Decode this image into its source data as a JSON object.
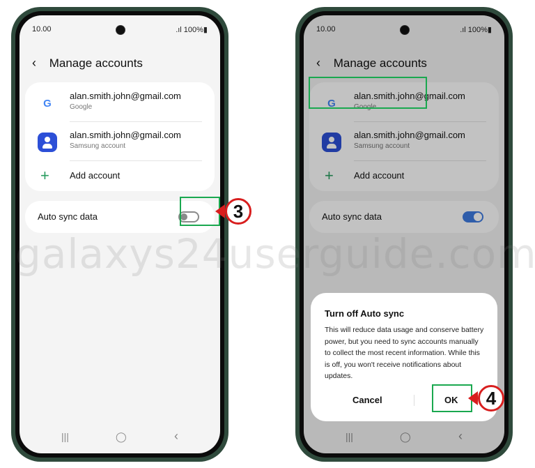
{
  "status_bar": {
    "time": "10.00",
    "signal_battery": ".ıl 100%▮"
  },
  "header": {
    "back_icon": "‹",
    "title": "Manage accounts"
  },
  "accounts": [
    {
      "email": "alan.smith.john@gmail.com",
      "type": "Google",
      "icon": "google-icon",
      "icon_glyph": "G"
    },
    {
      "email": "alan.smith.john@gmail.com",
      "type": "Samsung account",
      "icon": "samsung-account-icon"
    }
  ],
  "add_account": {
    "icon": "+",
    "label": "Add account"
  },
  "auto_sync": {
    "label": "Auto sync data"
  },
  "left_screen": {
    "auto_sync_on": false
  },
  "right_screen": {
    "auto_sync_on": true
  },
  "dialog": {
    "title": "Turn off Auto sync",
    "message": "This will reduce data usage and conserve battery power, but you need to sync accounts manually to collect the most recent information. While this is off, you won't receive notifications about updates.",
    "cancel_label": "Cancel",
    "ok_label": "OK"
  },
  "nav_bar": {
    "recents": "|||",
    "home": "◯",
    "back": "‹"
  },
  "callouts": {
    "step3": "3",
    "step4": "4"
  },
  "watermark": "galaxys24userguide.com",
  "colors": {
    "accent_green": "#1aa84f",
    "callout_red": "#d81e1e",
    "toggle_on": "#3f7be0"
  }
}
